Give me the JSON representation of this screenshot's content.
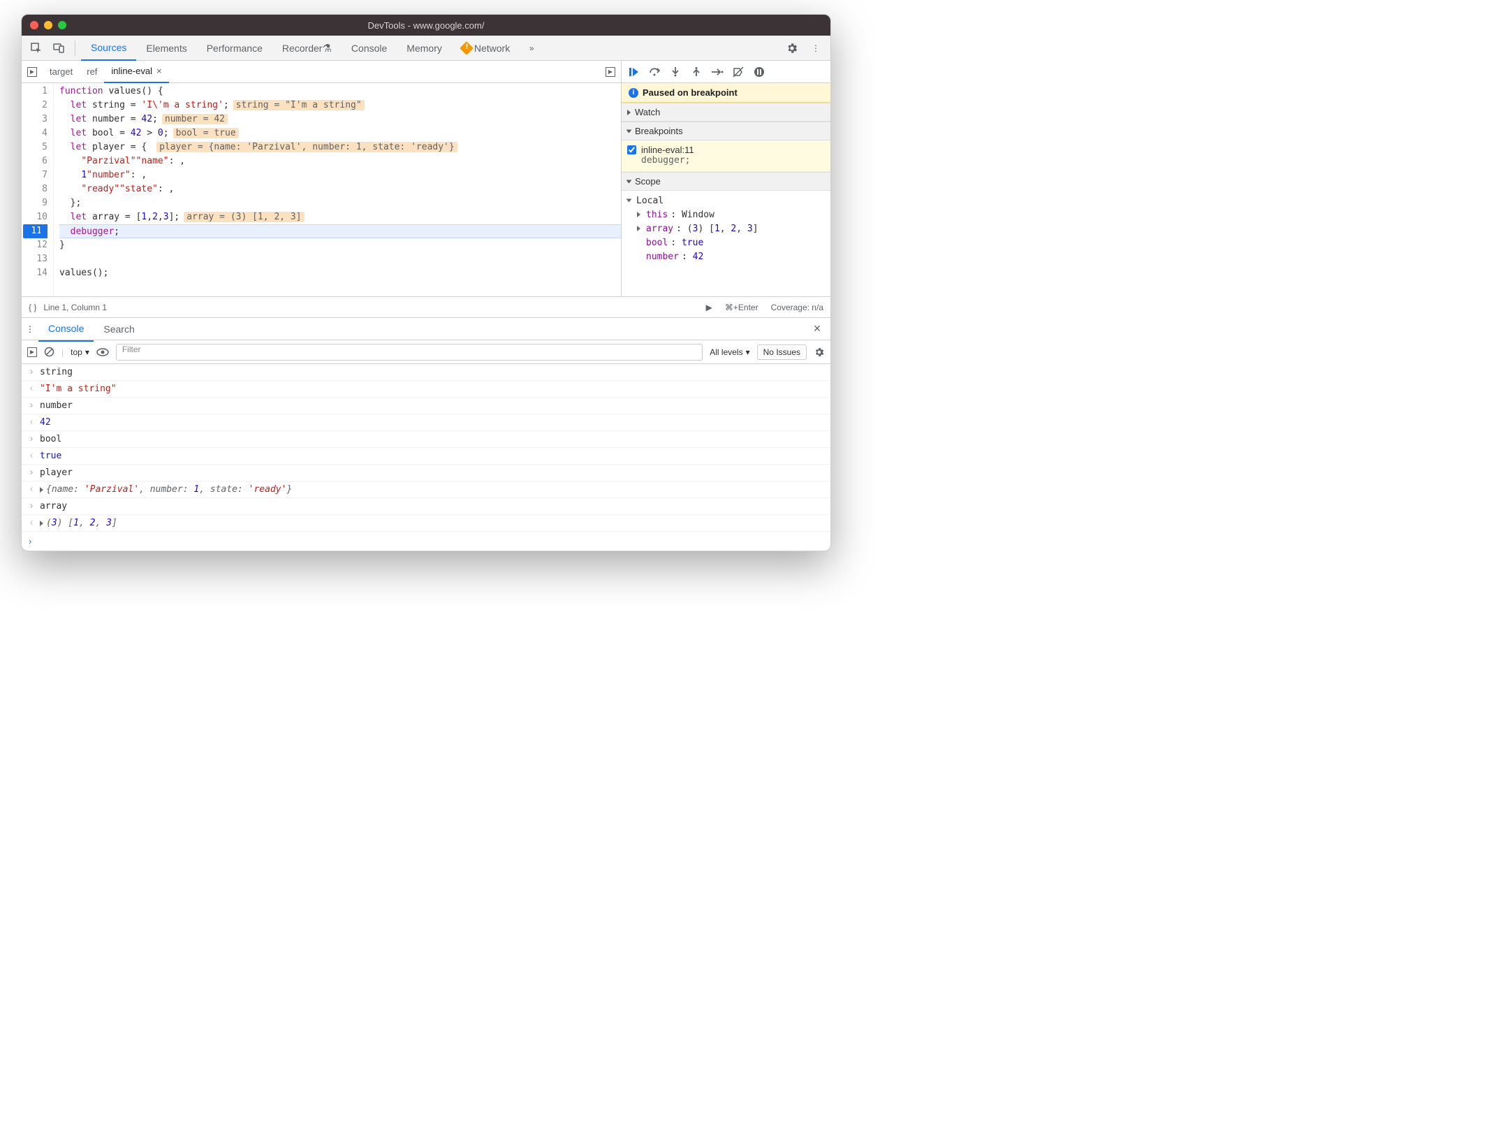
{
  "window": {
    "title": "DevTools - www.google.com/"
  },
  "tabs": {
    "items": [
      "Sources",
      "Elements",
      "Performance",
      "Recorder",
      "Console",
      "Memory",
      "Network"
    ],
    "active": 0,
    "has_warning_on": "Network"
  },
  "file_tabs": {
    "items": [
      "target",
      "ref",
      "inline-eval"
    ],
    "active": 2,
    "close_label": "×"
  },
  "code": {
    "lines": [
      {
        "n": 1,
        "pre": "function ",
        "kw": "",
        "mid": "values",
        "rest": "() {"
      },
      {
        "n": 2,
        "indent": "  ",
        "kw": "let",
        "name": " string = ",
        "str": "'I\\'m a string'",
        "tail": ";",
        "hint": "string = \"I'm a string\""
      },
      {
        "n": 3,
        "indent": "  ",
        "kw": "let",
        "name": " number = ",
        "num": "42",
        "tail": ";",
        "hint": "number = 42"
      },
      {
        "n": 4,
        "indent": "  ",
        "kw": "let",
        "name": " bool = ",
        "expr": "42 > 0",
        "tail": ";",
        "hint": "bool = true"
      },
      {
        "n": 5,
        "indent": "  ",
        "kw": "let",
        "name": " player = { ",
        "hint": "player = {name: 'Parzival', number: 1, state: 'ready'}"
      },
      {
        "n": 6,
        "indent": "    ",
        "prop": "\"name\"",
        "colon": ": ",
        "str": "\"Parzival\"",
        "tail": ","
      },
      {
        "n": 7,
        "indent": "    ",
        "prop": "\"number\"",
        "colon": ": ",
        "num": "1",
        "tail": ","
      },
      {
        "n": 8,
        "indent": "    ",
        "prop": "\"state\"",
        "colon": ": ",
        "str": "\"ready\"",
        "tail": ","
      },
      {
        "n": 9,
        "indent": "  ",
        "plain": "};"
      },
      {
        "n": 10,
        "indent": "  ",
        "kw": "let",
        "name": " array = [",
        "arr": "1,2,3",
        "tail": "];",
        "hint": "array = (3) [1, 2, 3]"
      },
      {
        "n": 11,
        "indent": "  ",
        "dbg": "debugger",
        "tail": ";",
        "current": true,
        "bp": true
      },
      {
        "n": 12,
        "plain": "}"
      },
      {
        "n": 13,
        "plain": ""
      },
      {
        "n": 14,
        "plain": "values();"
      }
    ]
  },
  "status": {
    "pos": "Line 1, Column 1",
    "run_hint": "⌘+Enter",
    "coverage": "Coverage: n/a"
  },
  "sidebar": {
    "pause": "Paused on breakpoint",
    "watch": "Watch",
    "breakpoints": "Breakpoints",
    "bp_item_label": "inline-eval:11",
    "bp_item_code": "debugger;",
    "scope": "Scope",
    "local_label": "Local",
    "local": [
      {
        "tri": true,
        "name": "this",
        "val": ": Window"
      },
      {
        "tri": true,
        "name": "array",
        "val": ": (3) [1, 2, 3]",
        "rich": true
      },
      {
        "name": "bool",
        "val": ": true",
        "blue": true
      },
      {
        "name": "number",
        "val": ": 42",
        "blue": true
      }
    ]
  },
  "drawer": {
    "tabs": [
      "Console",
      "Search"
    ],
    "active": 0
  },
  "console_bar": {
    "context": "top",
    "filter_placeholder": "Filter",
    "levels": "All levels",
    "issues": "No Issues"
  },
  "console": {
    "rows": [
      {
        "type": "in",
        "text": "string"
      },
      {
        "type": "out",
        "cls": "cred",
        "text": "\"I'm a string\""
      },
      {
        "type": "in",
        "text": "number"
      },
      {
        "type": "out",
        "cls": "cblue",
        "text": "42"
      },
      {
        "type": "in",
        "text": "bool"
      },
      {
        "type": "out",
        "cls": "cblue",
        "text": "true"
      },
      {
        "type": "in",
        "text": "player"
      },
      {
        "type": "out",
        "cls": "cital",
        "expand": true,
        "text": "{name: 'Parzival', number: 1, state: 'ready'}"
      },
      {
        "type": "in",
        "text": "array"
      },
      {
        "type": "out",
        "cls": "cital",
        "expand": true,
        "text": "(3) [1, 2, 3]"
      }
    ]
  }
}
